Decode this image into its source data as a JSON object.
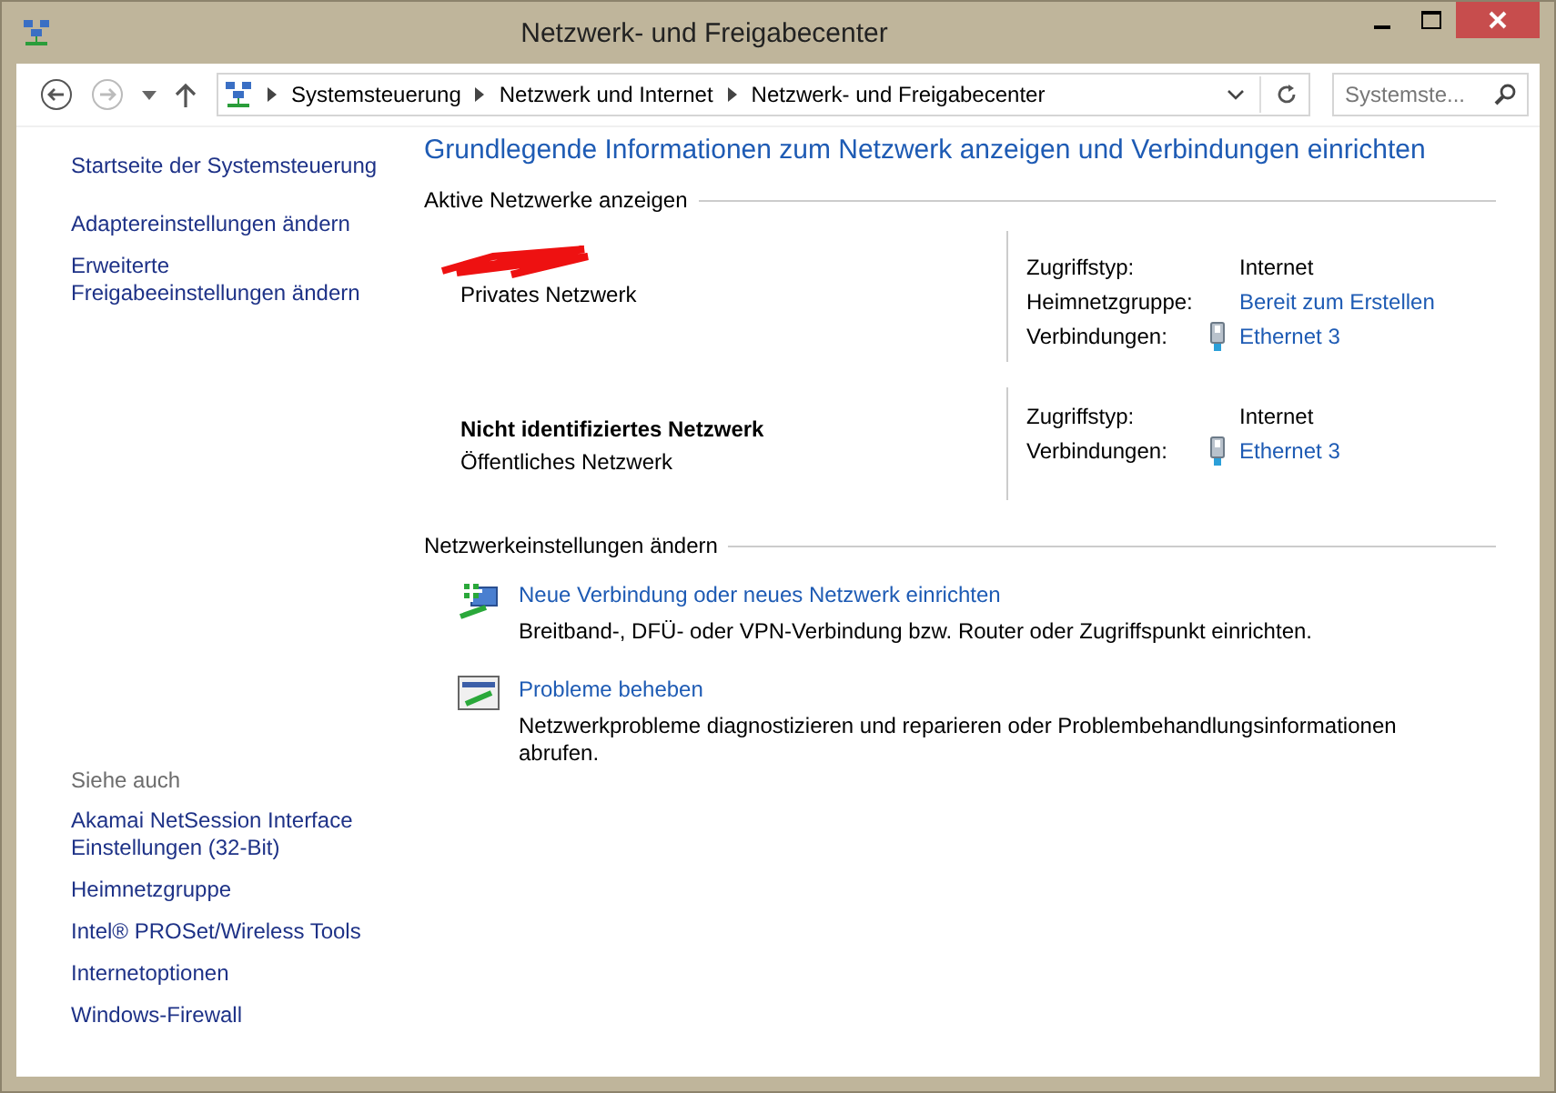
{
  "window": {
    "title": "Netzwerk- und Freigabecenter"
  },
  "address_bar": {
    "breadcrumbs": [
      "Systemsteuerung",
      "Netzwerk und Internet",
      "Netzwerk- und Freigabecenter"
    ],
    "search_placeholder": "Systemste..."
  },
  "sidebar": {
    "items": [
      "Startseite der Systemsteuerung",
      "Adaptereinstellungen ändern",
      "Erweiterte Freigabeeinstellungen ändern"
    ],
    "see_also_heading": "Siehe auch",
    "see_also": [
      "Akamai NetSession Interface Einstellungen (32-Bit)",
      "Heimnetzgruppe",
      "Intel® PROSet/Wireless Tools",
      "Internetoptionen",
      "Windows-Firewall"
    ]
  },
  "main": {
    "heading": "Grundlegende Informationen zum Netzwerk anzeigen und Verbindungen einrichten",
    "active_section": "Aktive Netzwerke anzeigen",
    "networks": [
      {
        "redacted": true,
        "category": "Privates Netzwerk",
        "properties": [
          {
            "label": "Zugriffstyp:",
            "value": "Internet",
            "kind": "text"
          },
          {
            "label": "Heimnetzgruppe:",
            "value": "Bereit zum Erstellen",
            "kind": "link"
          },
          {
            "label": "Verbindungen:",
            "value": "Ethernet 3",
            "kind": "adapter"
          }
        ]
      },
      {
        "redacted": false,
        "name": "Nicht identifiziertes Netzwerk",
        "category": "Öffentliches Netzwerk",
        "properties": [
          {
            "label": "Zugriffstyp:",
            "value": "Internet",
            "kind": "text"
          },
          {
            "label": "Verbindungen:",
            "value": "Ethernet 3",
            "kind": "adapter"
          }
        ]
      }
    ],
    "settings_section": "Netzwerkeinstellungen ändern",
    "tasks": [
      {
        "kind": "new-connection",
        "title": "Neue Verbindung oder neues Netzwerk einrichten",
        "description": "Breitband-, DFÜ- oder VPN-Verbindung bzw. Router oder Zugriffspunkt einrichten."
      },
      {
        "kind": "troubleshoot",
        "title": "Probleme beheben",
        "description": "Netzwerkprobleme diagnostizieren und reparieren oder Problembehandlungsinformationen abrufen."
      }
    ]
  }
}
